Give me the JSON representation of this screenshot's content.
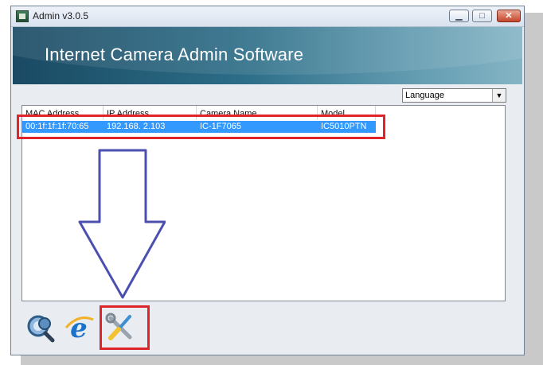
{
  "window": {
    "title": "Admin v3.0.5",
    "controls": {
      "minimize": "▁",
      "maximize": "□",
      "close": "✕"
    }
  },
  "banner": {
    "title": "Internet Camera Admin Software"
  },
  "language": {
    "selected": "Language"
  },
  "camera_list": {
    "columns": [
      "MAC Address",
      "IP Address",
      "Camera Name",
      "Model"
    ],
    "rows": [
      {
        "mac": "00:1f:1f:1f:70:65",
        "ip": "192.168.  2.103",
        "name": "IC-1F7065",
        "model": "IC5010PTN"
      }
    ],
    "selected_row_color": "#3399ff"
  },
  "toolbar": {
    "icons": [
      "search-camera-icon",
      "internet-explorer-icon",
      "setup-tools-icon"
    ]
  },
  "annotations": {
    "highlight_color": "#e0252a",
    "arrow_color": "#4b4fb0"
  }
}
